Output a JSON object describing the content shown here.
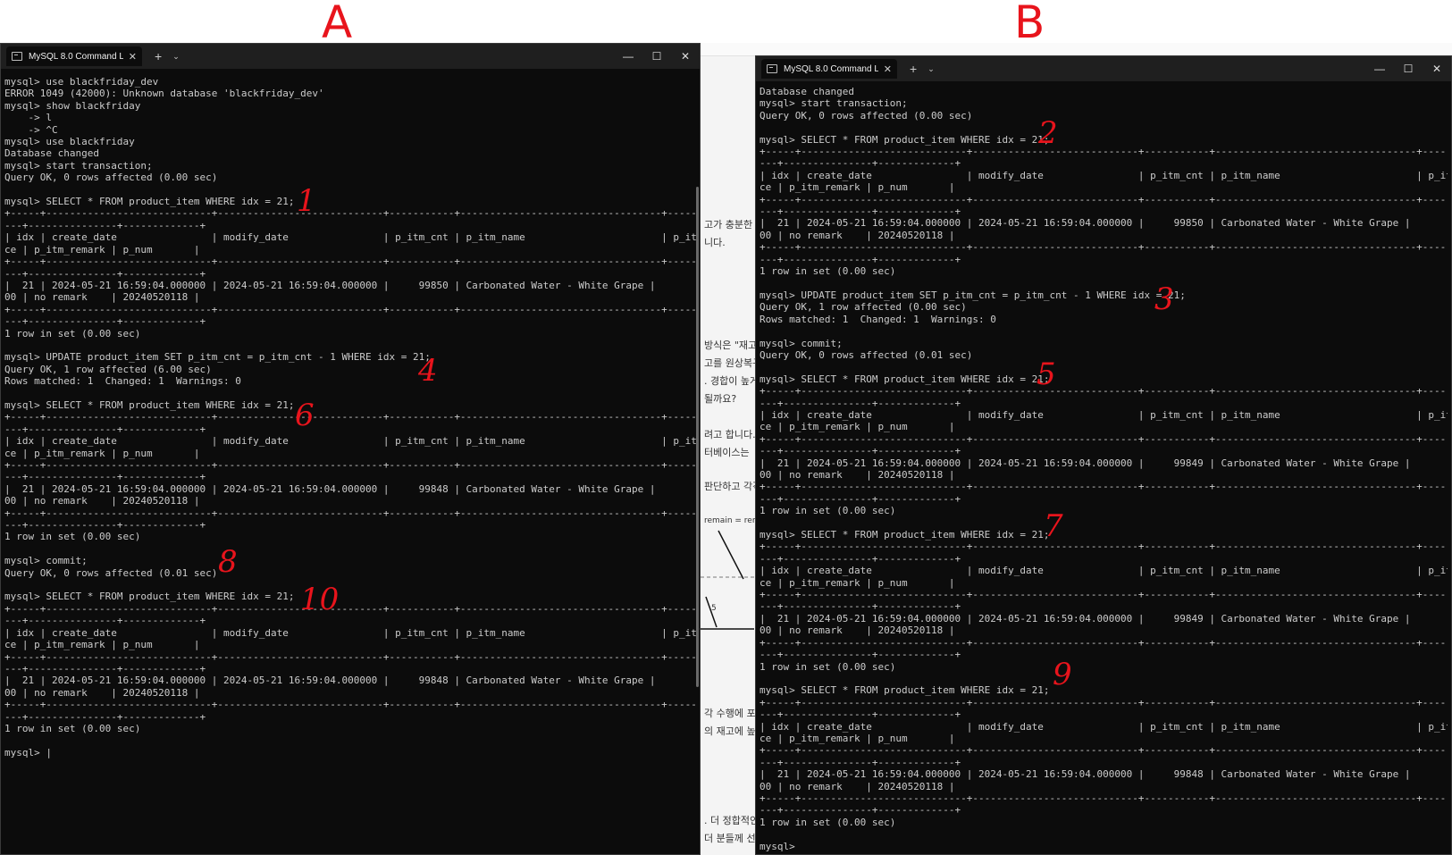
{
  "labels": {
    "left": "A",
    "right": "B"
  },
  "background_page": {
    "fragments": [
      "고가 충분한",
      "니다.",
      "방식은 \"재고",
      "고를 원상복구",
      ". 경합이 높게",
      "될까요?",
      "려고 합니다. A",
      "터베이스는",
      "판단하고 각각",
      "remain = rem",
      "5",
      "각 수행에 포",
      "의 재고에 높은",
      ". 더 정합적인",
      "더 분들께 선착"
    ]
  },
  "window_a": {
    "title": "MySQL 8.0 Command Line Cli",
    "close_glyph": "✕",
    "new_tab_glyph": "+",
    "menu_glyph": "⌄",
    "minimize_glyph": "—",
    "maximize_glyph": "☐",
    "window_close_glyph": "✕",
    "console_text": "mysql> use blackfriday_dev\nERROR 1049 (42000): Unknown database 'blackfriday_dev'\nmysql> show blackfriday\n    -> l\n    -> ^C\nmysql> use blackfriday\nDatabase changed\nmysql> start transaction;\nQuery OK, 0 rows affected (0.00 sec)\n\nmysql> SELECT * FROM product_item WHERE idx = 21;\n+-----+----------------------------+----------------------------+-----------+----------------------------------+--------------\n---+---------------+-------------+\n| idx | create_date                | modify_date                | p_itm_cnt | p_itm_name                       | p_itm_pri\nce | p_itm_remark | p_num       |\n+-----+----------------------------+----------------------------+-----------+----------------------------------+--------------\n---+---------------+-------------+\n|  21 | 2024-05-21 16:59:04.000000 | 2024-05-21 16:59:04.000000 |     99850 | Carbonated Water - White Grape |        10\n00 | no remark    | 20240520118 |\n+-----+----------------------------+----------------------------+-----------+----------------------------------+--------------\n---+---------------+-------------+\n1 row in set (0.00 sec)\n\nmysql> UPDATE product_item SET p_itm_cnt = p_itm_cnt - 1 WHERE idx = 21;\nQuery OK, 1 row affected (6.00 sec)\nRows matched: 1  Changed: 1  Warnings: 0\n\nmysql> SELECT * FROM product_item WHERE idx = 21;\n+-----+----------------------------+----------------------------+-----------+----------------------------------+--------------\n---+---------------+-------------+\n| idx | create_date                | modify_date                | p_itm_cnt | p_itm_name                       | p_itm_pri\nce | p_itm_remark | p_num       |\n+-----+----------------------------+----------------------------+-----------+----------------------------------+--------------\n---+---------------+-------------+\n|  21 | 2024-05-21 16:59:04.000000 | 2024-05-21 16:59:04.000000 |     99848 | Carbonated Water - White Grape |        10\n00 | no remark    | 20240520118 |\n+-----+----------------------------+----------------------------+-----------+----------------------------------+--------------\n---+---------------+-------------+\n1 row in set (0.00 sec)\n\nmysql> commit;\nQuery OK, 0 rows affected (0.01 sec)\n\nmysql> SELECT * FROM product_item WHERE idx = 21;\n+-----+----------------------------+----------------------------+-----------+----------------------------------+--------------\n---+---------------+-------------+\n| idx | create_date                | modify_date                | p_itm_cnt | p_itm_name                       | p_itm_pri\nce | p_itm_remark | p_num       |\n+-----+----------------------------+----------------------------+-----------+----------------------------------+--------------\n---+---------------+-------------+\n|  21 | 2024-05-21 16:59:04.000000 | 2024-05-21 16:59:04.000000 |     99848 | Carbonated Water - White Grape |        10\n00 | no remark    | 20240520118 |\n+-----+----------------------------+----------------------------+-----------+----------------------------------+--------------\n---+---------------+-------------+\n1 row in set (0.00 sec)\n\nmysql> |",
    "step_marks": [
      "1",
      "4",
      "6",
      "8",
      "10"
    ]
  },
  "window_b": {
    "title": "MySQL 8.0 Command Line Cli",
    "close_glyph": "✕",
    "new_tab_glyph": "+",
    "menu_glyph": "⌄",
    "minimize_glyph": "—",
    "maximize_glyph": "☐",
    "window_close_glyph": "✕",
    "console_text": "Database changed\nmysql> start transaction;\nQuery OK, 0 rows affected (0.00 sec)\n\nmysql> SELECT * FROM product_item WHERE idx = 21;\n+-----+----------------------------+----------------------------+-----------+----------------------------------+--------------\n---+---------------+-------------+\n| idx | create_date                | modify_date                | p_itm_cnt | p_itm_name                       | p_itm_pri\nce | p_itm_remark | p_num       |\n+-----+----------------------------+----------------------------+-----------+----------------------------------+--------------\n---+---------------+-------------+\n|  21 | 2024-05-21 16:59:04.000000 | 2024-05-21 16:59:04.000000 |     99850 | Carbonated Water - White Grape |        10\n00 | no remark    | 20240520118 |\n+-----+----------------------------+----------------------------+-----------+----------------------------------+--------------\n---+---------------+-------------+\n1 row in set (0.00 sec)\n\nmysql> UPDATE product_item SET p_itm_cnt = p_itm_cnt - 1 WHERE idx = 21;\nQuery OK, 1 row affected (0.00 sec)\nRows matched: 1  Changed: 1  Warnings: 0\n\nmysql> commit;\nQuery OK, 0 rows affected (0.01 sec)\n\nmysql> SELECT * FROM product_item WHERE idx = 21;\n+-----+----------------------------+----------------------------+-----------+----------------------------------+--------------\n---+---------------+-------------+\n| idx | create_date                | modify_date                | p_itm_cnt | p_itm_name                       | p_itm_pri\nce | p_itm_remark | p_num       |\n+-----+----------------------------+----------------------------+-----------+----------------------------------+--------------\n---+---------------+-------------+\n|  21 | 2024-05-21 16:59:04.000000 | 2024-05-21 16:59:04.000000 |     99849 | Carbonated Water - White Grape |        10\n00 | no remark    | 20240520118 |\n+-----+----------------------------+----------------------------+-----------+----------------------------------+--------------\n---+---------------+-------------+\n1 row in set (0.00 sec)\n\nmysql> SELECT * FROM product_item WHERE idx = 21;\n+-----+----------------------------+----------------------------+-----------+----------------------------------+--------------\n---+---------------+-------------+\n| idx | create_date                | modify_date                | p_itm_cnt | p_itm_name                       | p_itm_pri\nce | p_itm_remark | p_num       |\n+-----+----------------------------+----------------------------+-----------+----------------------------------+--------------\n---+---------------+-------------+\n|  21 | 2024-05-21 16:59:04.000000 | 2024-05-21 16:59:04.000000 |     99849 | Carbonated Water - White Grape |        10\n00 | no remark    | 20240520118 |\n+-----+----------------------------+----------------------------+-----------+----------------------------------+--------------\n---+---------------+-------------+\n1 row in set (0.00 sec)\n\nmysql> SELECT * FROM product_item WHERE idx = 21;\n+-----+----------------------------+----------------------------+-----------+----------------------------------+--------------\n---+---------------+-------------+\n| idx | create_date                | modify_date                | p_itm_cnt | p_itm_name                       | p_itm_pri\nce | p_itm_remark | p_num       |\n+-----+----------------------------+----------------------------+-----------+----------------------------------+--------------\n---+---------------+-------------+\n|  21 | 2024-05-21 16:59:04.000000 | 2024-05-21 16:59:04.000000 |     99848 | Carbonated Water - White Grape |        10\n00 | no remark    | 20240520118 |\n+-----+----------------------------+----------------------------+-----------+----------------------------------+--------------\n---+---------------+-------------+\n1 row in set (0.00 sec)\n\nmysql>",
    "step_marks": [
      "2",
      "3",
      "5",
      "7",
      "9"
    ]
  },
  "colors": {
    "terminal_bg": "#0c0c0c",
    "terminal_text": "#cccccc",
    "titlebar_bg": "#1f1f1f",
    "annotation": "#e8141c"
  },
  "icons": {
    "tab_icon": "terminal-icon",
    "tab_close": "close-icon",
    "new_tab": "plus-icon",
    "tab_menu": "chevron-down-icon",
    "minimize": "minimize-icon",
    "maximize": "maximize-icon",
    "window_close": "close-icon"
  }
}
